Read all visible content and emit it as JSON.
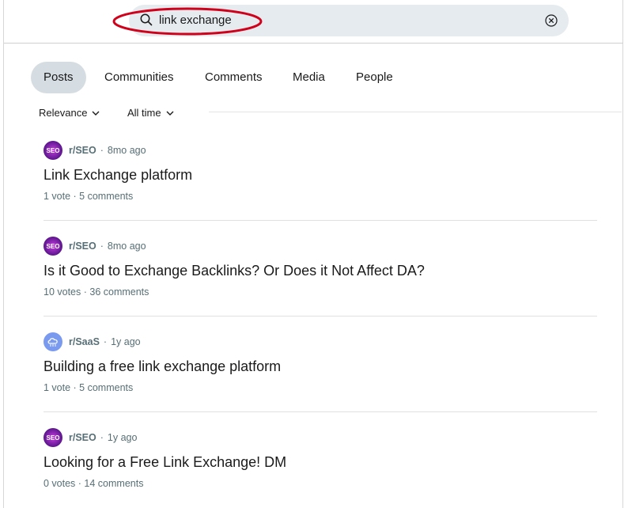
{
  "search": {
    "query": "link exchange"
  },
  "tabs": [
    {
      "label": "Posts",
      "active": true
    },
    {
      "label": "Communities",
      "active": false
    },
    {
      "label": "Comments",
      "active": false
    },
    {
      "label": "Media",
      "active": false
    },
    {
      "label": "People",
      "active": false
    }
  ],
  "filters": {
    "sort_label": "Relevance",
    "time_label": "All time"
  },
  "posts": [
    {
      "subreddit": "r/SEO",
      "age": "8mo ago",
      "title": "Link Exchange platform",
      "stats": "1 vote · 5 comments",
      "avatar_text": "SEO",
      "avatar_icon": "seo-avatar-icon"
    },
    {
      "subreddit": "r/SEO",
      "age": "8mo ago",
      "title": "Is it Good to Exchange Backlinks? Or Does it Not Affect DA?",
      "stats": "10 votes · 36 comments",
      "avatar_text": "SEO",
      "avatar_icon": "seo-avatar-icon"
    },
    {
      "subreddit": "r/SaaS",
      "age": "1y ago",
      "title": "Building a free link exchange platform",
      "stats": "1 vote · 5 comments",
      "avatar_text": "",
      "avatar_icon": "cloud-avatar-icon"
    },
    {
      "subreddit": "r/SEO",
      "age": "1y ago",
      "title": "Looking for a Free Link Exchange! DM",
      "stats": "0 votes · 14 comments",
      "avatar_text": "SEO",
      "avatar_icon": "seo-avatar-icon"
    }
  ],
  "colors": {
    "highlight": "#d0021b",
    "search_bg": "#e5ebee",
    "active_tab_bg": "#d5dde2"
  }
}
